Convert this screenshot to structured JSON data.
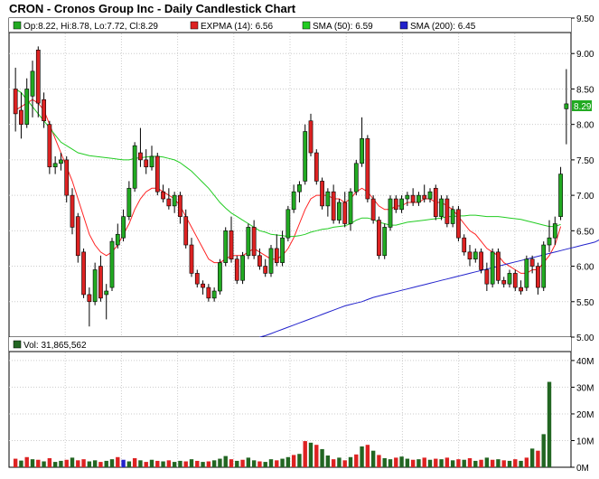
{
  "title": "CRON - Cronos Group Inc - Daily Candlestick Chart",
  "colors": {
    "up": "#22aa22",
    "down": "#dd2222",
    "expma": "#ff2222",
    "sma50": "#22cc22",
    "sma200": "#2222cc",
    "frame": "#000000",
    "grid": "#cccccc",
    "price_box": "#22aa22"
  },
  "legend": {
    "ohlc": "Op:8.22, Hi:8.78, Lo:7.72, Cl:8.29",
    "expma": "EXPMA (14): 6.56",
    "sma50": "SMA (50): 6.59",
    "sma200": "SMA (200): 6.45",
    "volume": "Vol: 31,865,562"
  },
  "last_price_label": "8.29",
  "chart_data": [
    {
      "type": "candlestick",
      "title": "CRON - Cronos Group Inc - Daily Candlestick Chart",
      "ylim": [
        5.0,
        9.5
      ],
      "y_ticks": [
        "9.50",
        "9.00",
        "8.50",
        "8.00",
        "7.50",
        "7.00",
        "6.50",
        "6.00",
        "5.50",
        "5.00"
      ],
      "grid": true,
      "legend_position": "top",
      "candles": [
        {
          "o": 8.5,
          "h": 8.8,
          "l": 7.9,
          "c": 8.15
        },
        {
          "o": 8.2,
          "h": 8.45,
          "l": 7.8,
          "c": 8.0
        },
        {
          "o": 8.0,
          "h": 8.65,
          "l": 7.95,
          "c": 8.5
        },
        {
          "o": 8.4,
          "h": 8.9,
          "l": 8.1,
          "c": 8.75
        },
        {
          "o": 9.05,
          "h": 9.1,
          "l": 8.1,
          "c": 8.3
        },
        {
          "o": 8.35,
          "h": 8.45,
          "l": 7.95,
          "c": 8.05
        },
        {
          "o": 8.0,
          "h": 8.05,
          "l": 7.3,
          "c": 7.4
        },
        {
          "o": 7.4,
          "h": 7.55,
          "l": 7.3,
          "c": 7.45
        },
        {
          "o": 7.45,
          "h": 7.6,
          "l": 7.35,
          "c": 7.5
        },
        {
          "o": 7.5,
          "h": 7.55,
          "l": 6.9,
          "c": 7.0
        },
        {
          "o": 7.0,
          "h": 7.1,
          "l": 6.45,
          "c": 6.55
        },
        {
          "o": 6.7,
          "h": 6.75,
          "l": 6.05,
          "c": 6.15
        },
        {
          "o": 6.2,
          "h": 6.25,
          "l": 5.55,
          "c": 5.6
        },
        {
          "o": 5.6,
          "h": 5.7,
          "l": 5.15,
          "c": 5.5
        },
        {
          "o": 5.5,
          "h": 6.05,
          "l": 5.45,
          "c": 5.95
        },
        {
          "o": 6.0,
          "h": 6.15,
          "l": 5.5,
          "c": 5.55
        },
        {
          "o": 5.6,
          "h": 5.75,
          "l": 5.25,
          "c": 5.65
        },
        {
          "o": 5.7,
          "h": 6.4,
          "l": 5.65,
          "c": 6.35
        },
        {
          "o": 6.3,
          "h": 6.6,
          "l": 6.25,
          "c": 6.45
        },
        {
          "o": 6.4,
          "h": 6.8,
          "l": 6.35,
          "c": 6.7
        },
        {
          "o": 6.7,
          "h": 7.2,
          "l": 6.65,
          "c": 7.1
        },
        {
          "o": 7.1,
          "h": 7.75,
          "l": 7.05,
          "c": 7.7
        },
        {
          "o": 7.6,
          "h": 7.95,
          "l": 7.4,
          "c": 7.5
        },
        {
          "o": 7.5,
          "h": 7.65,
          "l": 7.3,
          "c": 7.4
        },
        {
          "o": 7.4,
          "h": 7.7,
          "l": 7.35,
          "c": 7.55
        },
        {
          "o": 7.55,
          "h": 7.6,
          "l": 7.0,
          "c": 7.05
        },
        {
          "o": 7.05,
          "h": 7.15,
          "l": 6.9,
          "c": 6.95
        },
        {
          "o": 6.95,
          "h": 7.1,
          "l": 6.8,
          "c": 6.85
        },
        {
          "o": 6.85,
          "h": 7.05,
          "l": 6.75,
          "c": 7.0
        },
        {
          "o": 7.0,
          "h": 7.05,
          "l": 6.6,
          "c": 6.7
        },
        {
          "o": 6.7,
          "h": 6.8,
          "l": 6.25,
          "c": 6.3
        },
        {
          "o": 6.3,
          "h": 6.4,
          "l": 5.85,
          "c": 5.9
        },
        {
          "o": 5.9,
          "h": 5.95,
          "l": 5.7,
          "c": 5.75
        },
        {
          "o": 5.75,
          "h": 5.8,
          "l": 5.6,
          "c": 5.7
        },
        {
          "o": 5.7,
          "h": 5.75,
          "l": 5.5,
          "c": 5.55
        },
        {
          "o": 5.55,
          "h": 5.7,
          "l": 5.5,
          "c": 5.65
        },
        {
          "o": 5.65,
          "h": 6.1,
          "l": 5.6,
          "c": 6.05
        },
        {
          "o": 6.05,
          "h": 6.55,
          "l": 6.0,
          "c": 6.5
        },
        {
          "o": 6.5,
          "h": 6.7,
          "l": 6.05,
          "c": 6.1
        },
        {
          "o": 6.1,
          "h": 6.15,
          "l": 5.75,
          "c": 5.8
        },
        {
          "o": 5.8,
          "h": 6.2,
          "l": 5.75,
          "c": 6.15
        },
        {
          "o": 6.15,
          "h": 6.6,
          "l": 6.1,
          "c": 6.55
        },
        {
          "o": 6.55,
          "h": 6.65,
          "l": 6.1,
          "c": 6.15
        },
        {
          "o": 6.15,
          "h": 6.25,
          "l": 5.95,
          "c": 6.0
        },
        {
          "o": 6.0,
          "h": 6.1,
          "l": 5.85,
          "c": 5.9
        },
        {
          "o": 5.9,
          "h": 6.3,
          "l": 5.85,
          "c": 6.25
        },
        {
          "o": 6.25,
          "h": 6.45,
          "l": 6.0,
          "c": 6.05
        },
        {
          "o": 6.05,
          "h": 6.5,
          "l": 6.0,
          "c": 6.4
        },
        {
          "o": 6.4,
          "h": 6.85,
          "l": 6.35,
          "c": 6.8
        },
        {
          "o": 6.8,
          "h": 7.15,
          "l": 6.75,
          "c": 7.05
        },
        {
          "o": 7.05,
          "h": 7.2,
          "l": 6.9,
          "c": 7.15
        },
        {
          "o": 7.2,
          "h": 8.0,
          "l": 7.15,
          "c": 7.9
        },
        {
          "o": 8.05,
          "h": 8.15,
          "l": 7.55,
          "c": 7.6
        },
        {
          "o": 7.6,
          "h": 7.65,
          "l": 7.15,
          "c": 7.2
        },
        {
          "o": 7.2,
          "h": 7.25,
          "l": 6.8,
          "c": 6.85
        },
        {
          "o": 6.85,
          "h": 7.1,
          "l": 6.7,
          "c": 7.05
        },
        {
          "o": 7.05,
          "h": 7.15,
          "l": 6.6,
          "c": 6.65
        },
        {
          "o": 6.65,
          "h": 6.95,
          "l": 6.6,
          "c": 6.9
        },
        {
          "o": 6.9,
          "h": 7.05,
          "l": 6.55,
          "c": 6.6
        },
        {
          "o": 6.6,
          "h": 7.1,
          "l": 6.5,
          "c": 7.05
        },
        {
          "o": 7.05,
          "h": 7.5,
          "l": 7.0,
          "c": 7.45
        },
        {
          "o": 7.45,
          "h": 8.1,
          "l": 7.4,
          "c": 7.8
        },
        {
          "o": 7.8,
          "h": 7.85,
          "l": 6.9,
          "c": 6.95
        },
        {
          "o": 6.95,
          "h": 7.0,
          "l": 6.6,
          "c": 6.65
        },
        {
          "o": 6.65,
          "h": 6.7,
          "l": 6.1,
          "c": 6.15
        },
        {
          "o": 6.15,
          "h": 6.6,
          "l": 6.1,
          "c": 6.55
        },
        {
          "o": 6.55,
          "h": 7.0,
          "l": 6.5,
          "c": 6.95
        },
        {
          "o": 6.95,
          "h": 7.0,
          "l": 6.75,
          "c": 6.8
        },
        {
          "o": 6.8,
          "h": 7.0,
          "l": 6.75,
          "c": 6.95
        },
        {
          "o": 6.95,
          "h": 7.05,
          "l": 6.85,
          "c": 7.0
        },
        {
          "o": 7.0,
          "h": 7.1,
          "l": 6.85,
          "c": 6.9
        },
        {
          "o": 6.9,
          "h": 7.05,
          "l": 6.85,
          "c": 7.0
        },
        {
          "o": 7.0,
          "h": 7.15,
          "l": 6.9,
          "c": 6.95
        },
        {
          "o": 6.95,
          "h": 7.1,
          "l": 6.9,
          "c": 7.05
        },
        {
          "o": 7.1,
          "h": 7.15,
          "l": 6.65,
          "c": 6.7
        },
        {
          "o": 6.7,
          "h": 7.0,
          "l": 6.65,
          "c": 6.95
        },
        {
          "o": 6.95,
          "h": 7.0,
          "l": 6.55,
          "c": 6.6
        },
        {
          "o": 6.6,
          "h": 6.85,
          "l": 6.55,
          "c": 6.8
        },
        {
          "o": 6.8,
          "h": 6.85,
          "l": 6.35,
          "c": 6.4
        },
        {
          "o": 6.4,
          "h": 6.45,
          "l": 6.15,
          "c": 6.2
        },
        {
          "o": 6.2,
          "h": 6.3,
          "l": 6.0,
          "c": 6.1
        },
        {
          "o": 6.1,
          "h": 6.25,
          "l": 6.05,
          "c": 6.2
        },
        {
          "o": 6.2,
          "h": 6.25,
          "l": 5.9,
          "c": 5.95
        },
        {
          "o": 5.95,
          "h": 6.05,
          "l": 5.65,
          "c": 5.75
        },
        {
          "o": 5.75,
          "h": 6.25,
          "l": 5.7,
          "c": 6.2
        },
        {
          "o": 6.2,
          "h": 6.25,
          "l": 5.75,
          "c": 5.8
        },
        {
          "o": 5.8,
          "h": 5.85,
          "l": 5.7,
          "c": 5.75
        },
        {
          "o": 5.75,
          "h": 5.95,
          "l": 5.7,
          "c": 5.9
        },
        {
          "o": 5.9,
          "h": 5.95,
          "l": 5.65,
          "c": 5.7
        },
        {
          "o": 5.7,
          "h": 5.8,
          "l": 5.6,
          "c": 5.65
        },
        {
          "o": 5.7,
          "h": 6.15,
          "l": 5.65,
          "c": 6.1
        },
        {
          "o": 6.1,
          "h": 6.15,
          "l": 5.9,
          "c": 6.0
        },
        {
          "o": 6.0,
          "h": 6.05,
          "l": 5.6,
          "c": 5.7
        },
        {
          "o": 5.7,
          "h": 6.35,
          "l": 5.65,
          "c": 6.3
        },
        {
          "o": 6.3,
          "h": 6.65,
          "l": 6.2,
          "c": 6.4
        },
        {
          "o": 6.4,
          "h": 6.7,
          "l": 6.3,
          "c": 6.6
        },
        {
          "o": 6.7,
          "h": 7.4,
          "l": 6.65,
          "c": 7.3
        },
        {
          "o": 8.22,
          "h": 8.78,
          "l": 7.72,
          "c": 8.29
        }
      ],
      "series": [
        {
          "name": "EXPMA (14)",
          "values": [
            8.2,
            8.25,
            8.3,
            8.35,
            8.3,
            8.2,
            8.0,
            7.8,
            7.6,
            7.4,
            7.2,
            6.95,
            6.7,
            6.45,
            6.3,
            6.2,
            6.15,
            6.2,
            6.3,
            6.45,
            6.6,
            6.8,
            6.95,
            7.05,
            7.1,
            7.1,
            7.05,
            7.0,
            6.95,
            6.85,
            6.7,
            6.55,
            6.4,
            6.25,
            6.1,
            6.05,
            6.05,
            6.1,
            6.15,
            6.15,
            6.15,
            6.2,
            6.25,
            6.2,
            6.15,
            6.1,
            6.1,
            6.15,
            6.25,
            6.4,
            6.6,
            6.8,
            6.95,
            7.0,
            7.0,
            7.0,
            6.95,
            6.95,
            6.9,
            6.95,
            7.05,
            7.1,
            7.05,
            6.95,
            6.85,
            6.8,
            6.8,
            6.85,
            6.85,
            6.9,
            6.9,
            6.9,
            6.95,
            6.95,
            6.9,
            6.9,
            6.85,
            6.8,
            6.7,
            6.6,
            6.5,
            6.45,
            6.35,
            6.25,
            6.2,
            6.15,
            6.05,
            6.0,
            5.95,
            5.9,
            5.9,
            5.95,
            5.95,
            6.05,
            6.15,
            6.3,
            6.56
          ]
        },
        {
          "name": "SMA (50)",
          "values": [
            8.5,
            8.45,
            8.35,
            8.25,
            8.15,
            8.05,
            7.95,
            7.85,
            7.75,
            7.7,
            7.65,
            7.6,
            7.58,
            7.56,
            7.55,
            7.54,
            7.53,
            7.52,
            7.51,
            7.5,
            7.5,
            7.52,
            7.53,
            7.54,
            7.55,
            7.55,
            7.54,
            7.52,
            7.5,
            7.46,
            7.4,
            7.34,
            7.26,
            7.18,
            7.1,
            7.0,
            6.9,
            6.82,
            6.75,
            6.7,
            6.65,
            6.6,
            6.55,
            6.5,
            6.48,
            6.45,
            6.44,
            6.43,
            6.42,
            6.42,
            6.43,
            6.45,
            6.48,
            6.5,
            6.52,
            6.53,
            6.55,
            6.56,
            6.57,
            6.6,
            6.65,
            6.68,
            6.68,
            6.66,
            6.62,
            6.6,
            6.58,
            6.58,
            6.6,
            6.62,
            6.63,
            6.64,
            6.65,
            6.66,
            6.67,
            6.68,
            6.7,
            6.7,
            6.71,
            6.71,
            6.72,
            6.72,
            6.71,
            6.7,
            6.7,
            6.7,
            6.69,
            6.68,
            6.67,
            6.66,
            6.64,
            6.62,
            6.6,
            6.58,
            6.56,
            6.56,
            6.59
          ]
        },
        {
          "name": "SMA (200)",
          "start_index": 43,
          "values": [
            5.0,
            5.02,
            5.05,
            5.08,
            5.11,
            5.14,
            5.17,
            5.2,
            5.23,
            5.26,
            5.29,
            5.32,
            5.35,
            5.38,
            5.41,
            5.44,
            5.46,
            5.48,
            5.5,
            5.53,
            5.56,
            5.58,
            5.6,
            5.62,
            5.64,
            5.66,
            5.68,
            5.7,
            5.72,
            5.74,
            5.76,
            5.78,
            5.8,
            5.82,
            5.84,
            5.86,
            5.88,
            5.9,
            5.92,
            5.94,
            5.96,
            5.98,
            6.0,
            6.02,
            6.04,
            6.06,
            6.08,
            6.1,
            6.12,
            6.14,
            6.16,
            6.18,
            6.2,
            6.22,
            6.24,
            6.26,
            6.28,
            6.3,
            6.32,
            6.34,
            6.38,
            6.42,
            6.45
          ]
        }
      ]
    },
    {
      "type": "bar",
      "ylim": [
        0,
        42
      ],
      "y_ticks": [
        "40M",
        "30M",
        "20M",
        "10M",
        "0M"
      ],
      "values": [
        3.2,
        2.5,
        3.8,
        3.0,
        2.8,
        2.2,
        3.4,
        2.0,
        2.4,
        2.8,
        3.6,
        2.6,
        3.0,
        2.2,
        2.6,
        2.0,
        2.4,
        3.0,
        3.8,
        2.8,
        2.2,
        3.4,
        2.6,
        2.0,
        2.8,
        2.4,
        2.2,
        2.6,
        2.0,
        2.4,
        2.2,
        3.0,
        2.4,
        2.0,
        2.2,
        2.6,
        3.2,
        4.2,
        3.0,
        2.4,
        2.8,
        3.6,
        2.6,
        2.2,
        2.0,
        3.0,
        2.6,
        3.2,
        3.8,
        4.6,
        5.0,
        9.8,
        9.2,
        8.4,
        6.8,
        4.4,
        3.0,
        3.6,
        2.6,
        3.8,
        4.8,
        7.8,
        8.4,
        6.2,
        4.6,
        3.4,
        3.0,
        3.6,
        4.0,
        3.2,
        2.8,
        3.0,
        3.6,
        2.8,
        3.2,
        3.0,
        3.6,
        2.6,
        3.0,
        2.8,
        3.4,
        2.4,
        2.8,
        3.6,
        2.8,
        3.0,
        2.6,
        2.4,
        3.0,
        2.4,
        3.6,
        7.0,
        6.2,
        12.4,
        32.0
      ],
      "down_indices": [
        0,
        2,
        4,
        6,
        9,
        11,
        12,
        15,
        18,
        21,
        23,
        25,
        27,
        30,
        32,
        34,
        38,
        40,
        43,
        46,
        49,
        51,
        53,
        56,
        58,
        60,
        62,
        64,
        67,
        70,
        72,
        74,
        76,
        78,
        80,
        82,
        84,
        86,
        88,
        90,
        92
      ],
      "blue_indices": [
        19
      ]
    }
  ]
}
